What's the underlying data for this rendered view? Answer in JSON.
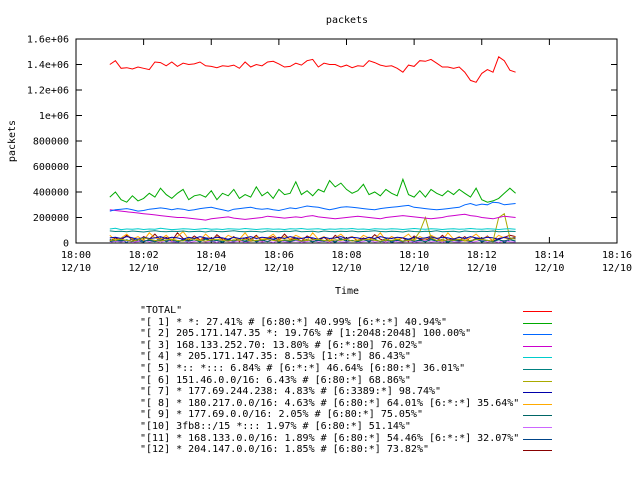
{
  "chart_data": {
    "type": "line",
    "title": "packets",
    "xlabel": "Time",
    "ylabel": "packets",
    "ylim": [
      0,
      1600000
    ],
    "yticks": [
      "0",
      "200000",
      "400000",
      "600000",
      "800000",
      "1e+06",
      "1.2e+06",
      "1.4e+06",
      "1.6e+06"
    ],
    "xticks": [
      {
        "time": "18:00",
        "date": "12/10"
      },
      {
        "time": "18:02",
        "date": "12/10"
      },
      {
        "time": "18:04",
        "date": "12/10"
      },
      {
        "time": "18:06",
        "date": "12/10"
      },
      {
        "time": "18:08",
        "date": "12/10"
      },
      {
        "time": "18:10",
        "date": "12/10"
      },
      {
        "time": "18:12",
        "date": "12/10"
      },
      {
        "time": "18:14",
        "date": "12/10"
      },
      {
        "time": "18:16",
        "date": "12/10"
      }
    ],
    "x_start": "18:01",
    "x_step": "10s",
    "grid": false,
    "legend_position": "bottom",
    "series": [
      {
        "name": "\"TOTAL\"",
        "color": "#ff0000",
        "values": [
          1400000,
          1430000,
          1370000,
          1375000,
          1365000,
          1380000,
          1370000,
          1360000,
          1420000,
          1415000,
          1390000,
          1420000,
          1385000,
          1410000,
          1400000,
          1405000,
          1420000,
          1390000,
          1385000,
          1375000,
          1390000,
          1385000,
          1395000,
          1370000,
          1420000,
          1380000,
          1400000,
          1390000,
          1420000,
          1425000,
          1405000,
          1380000,
          1385000,
          1410000,
          1395000,
          1430000,
          1440000,
          1380000,
          1410000,
          1400000,
          1400000,
          1380000,
          1395000,
          1375000,
          1390000,
          1385000,
          1430000,
          1415000,
          1395000,
          1385000,
          1390000,
          1370000,
          1340000,
          1395000,
          1385000,
          1430000,
          1425000,
          1440000,
          1410000,
          1380000,
          1380000,
          1370000,
          1380000,
          1340000,
          1275000,
          1260000,
          1330000,
          1360000,
          1340000,
          1460000,
          1430000,
          1355000,
          1340000
        ]
      },
      {
        "name": "\"[ 1] * *: 27.41% # [6:80:*] 40.99% [6:*:*] 40.94%\"",
        "color": "#00aa00",
        "values": [
          360000,
          400000,
          340000,
          320000,
          370000,
          330000,
          350000,
          390000,
          360000,
          430000,
          380000,
          350000,
          390000,
          420000,
          340000,
          370000,
          380000,
          360000,
          410000,
          340000,
          390000,
          370000,
          420000,
          350000,
          380000,
          360000,
          440000,
          370000,
          400000,
          350000,
          420000,
          380000,
          390000,
          480000,
          380000,
          410000,
          370000,
          420000,
          400000,
          490000,
          440000,
          470000,
          420000,
          390000,
          410000,
          460000,
          380000,
          400000,
          370000,
          420000,
          390000,
          370000,
          500000,
          380000,
          360000,
          410000,
          360000,
          420000,
          390000,
          370000,
          410000,
          380000,
          420000,
          390000,
          360000,
          430000,
          340000,
          320000,
          330000,
          350000,
          390000,
          430000,
          390000
        ]
      },
      {
        "name": "\"[ 2] 205.171.147.35 *: 19.76% # [1:2048:2048] 100.00%\"",
        "color": "#0066ff",
        "values": [
          250000,
          260000,
          265000,
          270000,
          260000,
          250000,
          255000,
          265000,
          270000,
          275000,
          270000,
          260000,
          270000,
          265000,
          255000,
          260000,
          270000,
          275000,
          280000,
          270000,
          260000,
          250000,
          265000,
          270000,
          275000,
          280000,
          270000,
          265000,
          270000,
          260000,
          255000,
          265000,
          275000,
          270000,
          280000,
          290000,
          285000,
          280000,
          270000,
          260000,
          270000,
          280000,
          285000,
          280000,
          275000,
          270000,
          265000,
          260000,
          270000,
          275000,
          280000,
          285000,
          290000,
          295000,
          280000,
          275000,
          270000,
          265000,
          260000,
          265000,
          270000,
          275000,
          280000,
          300000,
          310000,
          295000,
          305000,
          300000,
          320000,
          315000,
          300000,
          305000,
          310000
        ]
      },
      {
        "name": "\"[ 3] 168.133.252.70: 13.80% # [6:*:80] 76.02%\"",
        "color": "#cc00cc",
        "values": [
          260000,
          255000,
          250000,
          245000,
          240000,
          235000,
          230000,
          225000,
          220000,
          215000,
          210000,
          205000,
          200000,
          200000,
          195000,
          190000,
          185000,
          180000,
          190000,
          195000,
          200000,
          205000,
          195000,
          190000,
          185000,
          190000,
          195000,
          200000,
          210000,
          205000,
          200000,
          195000,
          200000,
          205000,
          200000,
          210000,
          215000,
          205000,
          200000,
          195000,
          190000,
          195000,
          200000,
          205000,
          210000,
          205000,
          200000,
          195000,
          190000,
          200000,
          205000,
          210000,
          215000,
          210000,
          205000,
          200000,
          195000,
          190000,
          195000,
          200000,
          210000,
          215000,
          220000,
          225000,
          215000,
          210000,
          200000,
          195000,
          190000,
          200000,
          210000,
          205000,
          200000
        ]
      },
      {
        "name": "\"[ 4] * 205.171.147.35: 8.53% [1:*:*] 86.43%\"",
        "color": "#00cccc",
        "values": [
          110000,
          115000,
          105000,
          110000,
          108000,
          112000,
          106000,
          110000,
          108000,
          115000,
          110000,
          105000,
          108000,
          112000,
          110000,
          106000,
          110000,
          114000,
          108000,
          110000,
          106000,
          112000,
          110000,
          108000,
          114000,
          110000,
          106000,
          110000,
          112000,
          108000,
          110000,
          106000,
          112000,
          110000,
          114000,
          108000,
          110000,
          112000,
          106000,
          110000,
          108000,
          112000,
          110000,
          114000,
          108000,
          110000,
          106000,
          112000,
          110000,
          108000,
          112000,
          110000,
          106000,
          110000,
          114000,
          110000,
          108000,
          112000,
          110000,
          106000,
          110000,
          112000,
          108000,
          110000,
          114000,
          110000,
          108000,
          112000,
          110000,
          106000,
          110000,
          112000,
          108000
        ]
      },
      {
        "name": "\"[ 5] *:: *::: 6.84% # [6:*:*] 46.64% [6:80:*] 36.01%\"",
        "color": "#008080",
        "values": [
          95000,
          90000,
          92000,
          88000,
          94000,
          90000,
          86000,
          92000,
          96000,
          90000,
          88000,
          92000,
          90000,
          94000,
          88000,
          90000,
          92000,
          86000,
          94000,
          90000,
          88000,
          92000,
          96000,
          90000,
          88000,
          92000,
          90000,
          86000,
          94000,
          90000,
          88000,
          92000,
          90000,
          96000,
          88000,
          90000,
          92000,
          86000,
          94000,
          90000,
          88000,
          92000,
          90000,
          94000,
          88000,
          90000,
          92000,
          96000,
          90000,
          88000,
          92000,
          90000,
          86000,
          94000,
          90000,
          88000,
          92000,
          90000,
          96000,
          88000,
          90000,
          92000,
          86000,
          94000,
          90000,
          88000,
          92000,
          90000,
          94000,
          88000,
          90000,
          92000,
          90000
        ]
      },
      {
        "name": "\"[ 6] 151.46.0.0/16: 6.43% # [6:80:*] 68.86%\"",
        "color": "#aaaa00",
        "values": [
          20000,
          25000,
          30000,
          20000,
          15000,
          25000,
          40000,
          30000,
          20000,
          15000,
          25000,
          30000,
          20000,
          15000,
          35000,
          25000,
          20000,
          15000,
          25000,
          30000,
          20000,
          15000,
          25000,
          20000,
          30000,
          15000,
          20000,
          25000,
          30000,
          20000,
          15000,
          25000,
          20000,
          30000,
          15000,
          20000,
          25000,
          30000,
          20000,
          15000,
          25000,
          20000,
          30000,
          15000,
          20000,
          25000,
          30000,
          20000,
          15000,
          25000,
          20000,
          30000,
          15000,
          20000,
          25000,
          90000,
          200000,
          40000,
          20000,
          15000,
          25000,
          20000,
          30000,
          15000,
          20000,
          25000,
          30000,
          20000,
          15000,
          200000,
          230000,
          40000,
          30000
        ]
      },
      {
        "name": "\"[ 7] * 177.69.244.238: 4.83% # [6:3389:*] 98.74%\"",
        "color": "#0000aa",
        "values": [
          40000,
          45000,
          35000,
          50000,
          40000,
          30000,
          45000,
          35000,
          40000,
          50000,
          35000,
          45000,
          40000,
          30000,
          45000,
          35000,
          50000,
          40000,
          35000,
          45000,
          40000,
          30000,
          45000,
          35000,
          40000,
          50000,
          35000,
          45000,
          40000,
          30000,
          45000,
          35000,
          50000,
          40000,
          35000,
          45000,
          40000,
          30000,
          45000,
          35000,
          40000,
          50000,
          35000,
          45000,
          40000,
          30000,
          45000,
          35000,
          50000,
          40000,
          35000,
          45000,
          40000,
          30000,
          45000,
          35000,
          40000,
          50000,
          35000,
          45000,
          40000,
          30000,
          45000,
          35000,
          50000,
          40000,
          35000,
          45000,
          40000,
          30000,
          45000,
          35000,
          40000
        ]
      },
      {
        "name": "\"[ 8] * 180.217.0.0/16: 4.63% # [6:80:*] 64.01% [6:*:*] 35.64%\"",
        "color": "#ffaa00",
        "values": [
          60000,
          20000,
          40000,
          70000,
          30000,
          50000,
          20000,
          80000,
          40000,
          30000,
          60000,
          20000,
          50000,
          90000,
          30000,
          40000,
          20000,
          70000,
          30000,
          50000,
          20000,
          60000,
          40000,
          30000,
          80000,
          20000,
          50000,
          30000,
          40000,
          70000,
          20000,
          50000,
          30000,
          60000,
          40000,
          20000,
          80000,
          30000,
          50000,
          20000,
          40000,
          70000,
          30000,
          50000,
          20000,
          60000,
          40000,
          30000,
          80000,
          20000,
          50000,
          30000,
          40000,
          70000,
          20000,
          50000,
          30000,
          60000,
          40000,
          20000,
          80000,
          30000,
          50000,
          20000,
          40000,
          70000,
          30000,
          50000,
          20000,
          60000,
          40000,
          30000,
          50000
        ]
      },
      {
        "name": "\"[ 9] * 177.69.0.0/16: 2.05% # [6:80:*] 75.05%\"",
        "color": "#006666",
        "values": [
          10000,
          20000,
          15000,
          25000,
          10000,
          30000,
          15000,
          20000,
          10000,
          25000,
          15000,
          30000,
          10000,
          20000,
          15000,
          25000,
          10000,
          30000,
          15000,
          20000,
          10000,
          25000,
          15000,
          30000,
          10000,
          20000,
          15000,
          25000,
          10000,
          30000,
          15000,
          20000,
          10000,
          25000,
          15000,
          30000,
          10000,
          20000,
          15000,
          25000,
          10000,
          30000,
          15000,
          20000,
          10000,
          25000,
          15000,
          30000,
          10000,
          20000,
          15000,
          25000,
          10000,
          30000,
          15000,
          20000,
          10000,
          25000,
          15000,
          30000,
          10000,
          20000,
          15000,
          25000,
          10000,
          30000,
          15000,
          20000,
          10000,
          25000,
          15000,
          30000,
          15000
        ]
      },
      {
        "name": "\"[10] 3fb8::/15 *::: 1.97% # [6:80:*] 51.14%\"",
        "color": "#cc66ff",
        "values": [
          5000,
          15000,
          8000,
          20000,
          5000,
          12000,
          25000,
          8000,
          15000,
          5000,
          20000,
          10000,
          8000,
          18000,
          5000,
          12000,
          22000,
          8000,
          15000,
          5000,
          20000,
          10000,
          8000,
          18000,
          5000,
          12000,
          22000,
          8000,
          15000,
          5000,
          20000,
          10000,
          8000,
          18000,
          5000,
          12000,
          22000,
          8000,
          15000,
          5000,
          20000,
          10000,
          8000,
          18000,
          5000,
          12000,
          22000,
          8000,
          15000,
          5000,
          20000,
          10000,
          8000,
          18000,
          5000,
          12000,
          22000,
          8000,
          15000,
          5000,
          20000,
          10000,
          8000,
          18000,
          5000,
          12000,
          22000,
          8000,
          15000,
          5000,
          20000,
          10000,
          8000
        ]
      },
      {
        "name": "\"[11] * 168.133.0.0/16: 1.89% # [6:80:*] 54.46% [6:*:*] 32.07%\"",
        "color": "#004488",
        "values": [
          30000,
          10000,
          25000,
          5000,
          35000,
          15000,
          8000,
          28000,
          12000,
          40000,
          10000,
          20000,
          5000,
          30000,
          15000,
          25000,
          8000,
          35000,
          12000,
          20000,
          5000,
          30000,
          10000,
          25000,
          15000,
          35000,
          8000,
          20000,
          12000,
          30000,
          5000,
          25000,
          15000,
          35000,
          10000,
          20000,
          8000,
          30000,
          12000,
          25000,
          5000,
          35000,
          15000,
          20000,
          10000,
          30000,
          8000,
          25000,
          12000,
          35000,
          5000,
          20000,
          15000,
          30000,
          10000,
          25000,
          8000,
          35000,
          12000,
          20000,
          5000,
          30000,
          15000,
          25000,
          10000,
          35000,
          8000,
          20000,
          12000,
          30000,
          5000,
          25000,
          15000
        ]
      },
      {
        "name": "\"[12] * 204.147.0.0/16: 1.85% # [6:80:*] 73.82%\"",
        "color": "#880000",
        "values": [
          15000,
          40000,
          20000,
          60000,
          25000,
          10000,
          50000,
          30000,
          70000,
          20000,
          45000,
          15000,
          80000,
          35000,
          20000,
          55000,
          25000,
          40000,
          15000,
          65000,
          30000,
          20000,
          50000,
          10000,
          40000,
          25000,
          60000,
          15000,
          35000,
          50000,
          20000,
          70000,
          25000,
          40000,
          15000,
          55000,
          30000,
          20000,
          45000,
          10000,
          60000,
          25000,
          35000,
          50000,
          15000,
          40000,
          20000,
          65000,
          30000,
          15000,
          50000,
          25000,
          40000,
          10000,
          55000,
          30000,
          20000,
          45000,
          15000,
          60000,
          25000,
          35000,
          20000,
          50000,
          10000,
          40000,
          25000,
          55000,
          15000,
          35000,
          45000,
          60000,
          50000
        ]
      }
    ]
  }
}
